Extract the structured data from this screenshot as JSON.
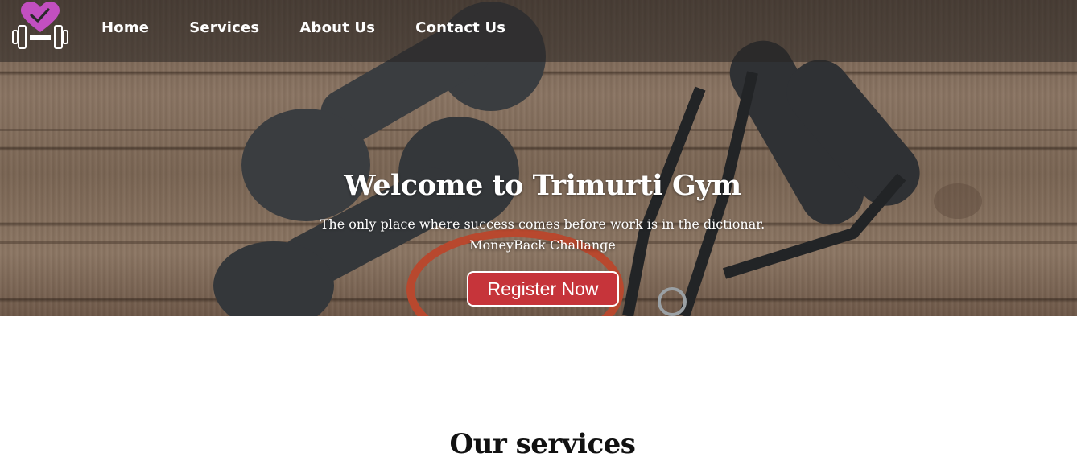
{
  "brand": {
    "logo_icon": "dumbbell-heart-check-icon",
    "logo_color": "#c24fc0"
  },
  "nav": {
    "items": [
      {
        "label": "Home"
      },
      {
        "label": "Services"
      },
      {
        "label": "About Us"
      },
      {
        "label": "Contact Us"
      }
    ]
  },
  "hero": {
    "title": "Welcome to Trimurti Gym",
    "subtitle_line1": "The only place where success comes before work is in the dictionar.",
    "subtitle_line2": "MoneyBack Challange",
    "cta_label": "Register Now",
    "cta_color": "#c6343a"
  },
  "services": {
    "heading": "Our services"
  }
}
